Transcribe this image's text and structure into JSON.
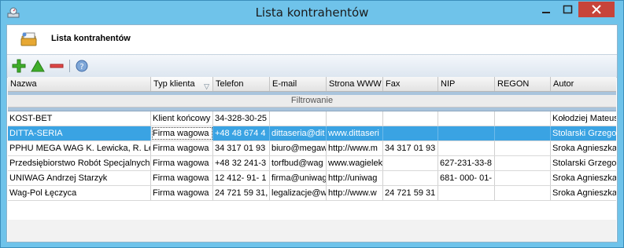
{
  "window": {
    "title": "Lista kontrahentów"
  },
  "header": {
    "title": "Lista kontrahentów"
  },
  "toolbar": {
    "buttons": [
      "add",
      "edit",
      "delete",
      "help"
    ]
  },
  "grid": {
    "columns": [
      "Nazwa",
      "Typ klienta",
      "Telefon",
      "E-mail",
      "Strona WWW",
      "Fax",
      "NIP",
      "REGON",
      "Autor"
    ],
    "filter_label": "Filtrowanie",
    "rows": [
      [
        "KOST-BET",
        "Klient końcowy",
        "34-328-30-25",
        "",
        "",
        "",
        "",
        "",
        "Kołodziej Mateus"
      ],
      [
        "DITTA-SERIA",
        "Firma wagowa ·",
        "+48 48 674 4",
        "dittaseria@dit",
        "www.dittaseri",
        "",
        "",
        "",
        "Stolarski Grzegor"
      ],
      [
        "PPHU MEGA WAG K. Lewicka, R. Lew",
        "Firma wagowa ·",
        "34 317 01 93",
        "biuro@megaw",
        "http://www.m",
        "34 317 01 93",
        "",
        "",
        "Sroka Agnieszka"
      ],
      [
        "Przedsiębiorstwo Robót Specjalnych",
        "Firma wagowa ·",
        "+48 32 241-3",
        "torfbud@wag",
        "www.wagielek",
        "",
        "627-231-33-8",
        "",
        "Stolarski Grzegor"
      ],
      [
        "UNIWAG Andrzej Starzyk",
        "Firma wagowa ·",
        "12 412- 91- 1",
        "firma@uniwag",
        "http://uniwag",
        "",
        "681- 000- 01-",
        "",
        "Sroka Agnieszka"
      ],
      [
        "Wag-Pol Łęczyca",
        "Firma wagowa ·",
        "24 721 59 31,",
        "legalizacje@w",
        "http://www.w",
        "24 721 59 31",
        "",
        "",
        "Sroka Agnieszka"
      ]
    ]
  }
}
